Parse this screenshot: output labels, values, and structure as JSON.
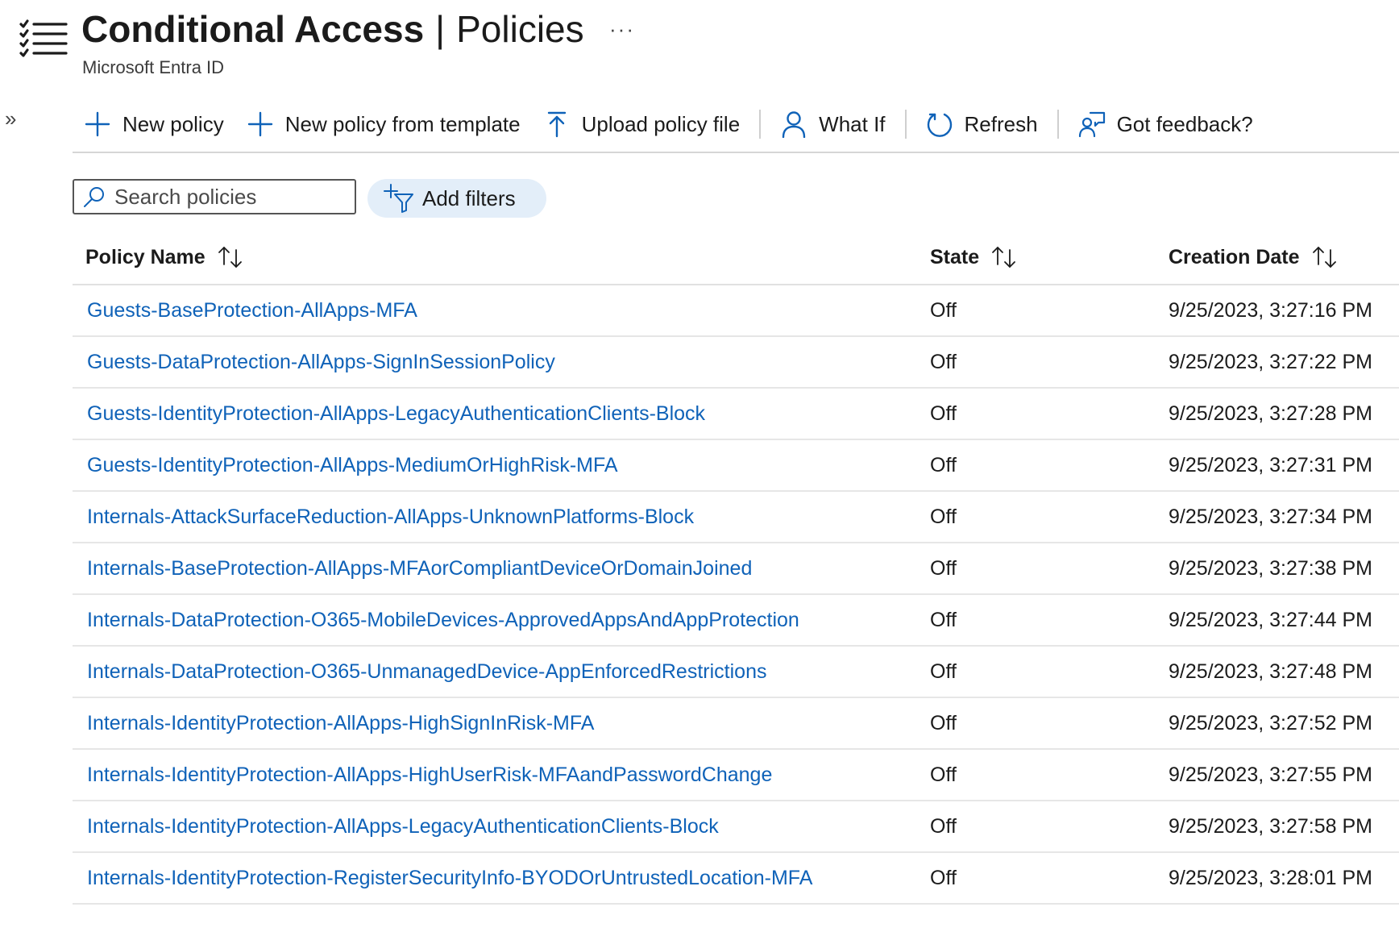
{
  "header": {
    "title_main": "Conditional Access",
    "title_separator": "|",
    "title_sub": "Policies",
    "subtitle": "Microsoft Entra ID",
    "more_label": "···",
    "expand_label": "»",
    "icon": "list-icon"
  },
  "toolbar": {
    "new_policy": "New policy",
    "new_policy_from_template": "New policy from template",
    "upload_policy_file": "Upload policy file",
    "what_if": "What If",
    "refresh": "Refresh",
    "got_feedback": "Got feedback?"
  },
  "search": {
    "placeholder": "Search policies",
    "value": ""
  },
  "filters": {
    "label": "Add filters"
  },
  "table": {
    "columns": {
      "name": "Policy Name",
      "state": "State",
      "date": "Creation Date"
    },
    "rows": [
      {
        "name": "Guests-BaseProtection-AllApps-MFA",
        "state": "Off",
        "date": "9/25/2023, 3:27:16 PM"
      },
      {
        "name": "Guests-DataProtection-AllApps-SignInSessionPolicy",
        "state": "Off",
        "date": "9/25/2023, 3:27:22 PM"
      },
      {
        "name": "Guests-IdentityProtection-AllApps-LegacyAuthenticationClients-Block",
        "state": "Off",
        "date": "9/25/2023, 3:27:28 PM"
      },
      {
        "name": "Guests-IdentityProtection-AllApps-MediumOrHighRisk-MFA",
        "state": "Off",
        "date": "9/25/2023, 3:27:31 PM"
      },
      {
        "name": "Internals-AttackSurfaceReduction-AllApps-UnknownPlatforms-Block",
        "state": "Off",
        "date": "9/25/2023, 3:27:34 PM"
      },
      {
        "name": "Internals-BaseProtection-AllApps-MFAorCompliantDeviceOrDomainJoined",
        "state": "Off",
        "date": "9/25/2023, 3:27:38 PM"
      },
      {
        "name": "Internals-DataProtection-O365-MobileDevices-ApprovedAppsAndAppProtection",
        "state": "Off",
        "date": "9/25/2023, 3:27:44 PM"
      },
      {
        "name": "Internals-DataProtection-O365-UnmanagedDevice-AppEnforcedRestrictions",
        "state": "Off",
        "date": "9/25/2023, 3:27:48 PM"
      },
      {
        "name": "Internals-IdentityProtection-AllApps-HighSignInRisk-MFA",
        "state": "Off",
        "date": "9/25/2023, 3:27:52 PM"
      },
      {
        "name": "Internals-IdentityProtection-AllApps-HighUserRisk-MFAandPasswordChange",
        "state": "Off",
        "date": "9/25/2023, 3:27:55 PM"
      },
      {
        "name": "Internals-IdentityProtection-AllApps-LegacyAuthenticationClients-Block",
        "state": "Off",
        "date": "9/25/2023, 3:27:58 PM"
      },
      {
        "name": "Internals-IdentityProtection-RegisterSecurityInfo-BYODOrUntrustedLocation-MFA",
        "state": "Off",
        "date": "9/25/2023, 3:28:01 PM"
      }
    ]
  },
  "colors": {
    "link": "#0f62b8",
    "accent": "#0f62b8",
    "filter_pill_bg": "#e3eef9",
    "text": "#1b1b1b"
  }
}
